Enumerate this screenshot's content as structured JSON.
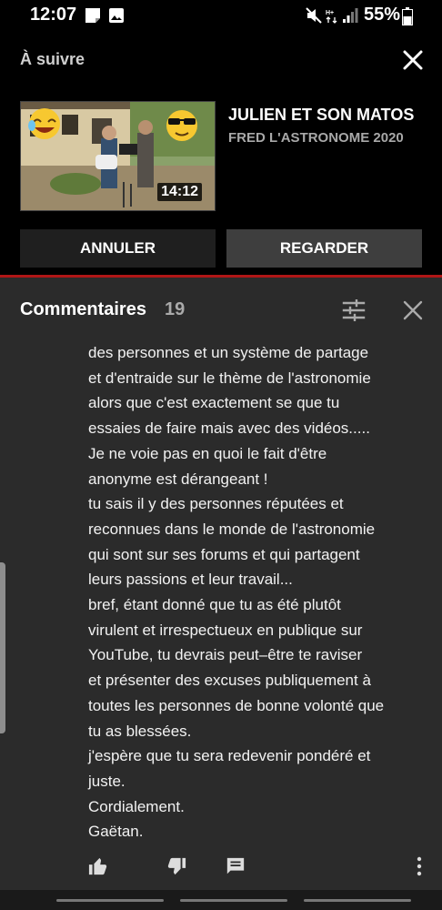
{
  "status_bar": {
    "time": "12:07",
    "battery": "55%",
    "icons": [
      "notes-icon",
      "image-icon",
      "mute-icon",
      "data-icon",
      "signal-icon",
      "battery-icon"
    ]
  },
  "up_next": {
    "label": "À suivre",
    "video": {
      "title": "JULIEN ET SON MATOS",
      "channel": "FRED L'ASTRONOME 2020",
      "duration": "14:12"
    },
    "cancel_label": "ANNULER",
    "watch_label": "REGARDER"
  },
  "comments": {
    "title": "Commentaires",
    "count": "19",
    "body_lines": [
      "des personnes et un système de partage",
      "et d'entraide sur le thème de l'astronomie",
      "alors que c'est exactement se que tu",
      "essaies de faire mais avec des vidéos.....",
      "Je ne voie pas en quoi le fait d'être",
      "anonyme est dérangeant !",
      "tu sais il y des personnes réputées et",
      "reconnues dans le monde de l'astronomie",
      "qui sont sur ses forums et qui partagent",
      "leurs passions et leur travail...",
      "bref, étant donné que tu as été plutôt",
      "virulent et irrespectueux en publique sur",
      "YouTube,  tu devrais peut–être te raviser",
      "et présenter des excuses publiquement à",
      "toutes les personnes de bonne volonté que",
      "tu as blessées.",
      "j'espère que tu sera redevenir pondéré et",
      "juste.",
      "Cordialement.",
      "Gaëtan."
    ]
  },
  "colors": {
    "background": "#000000",
    "comments_bg": "#2b2b2b",
    "accent_red": "#b01616",
    "button_dark": "#1f1f1f",
    "button_grey": "#3e3e3e"
  }
}
